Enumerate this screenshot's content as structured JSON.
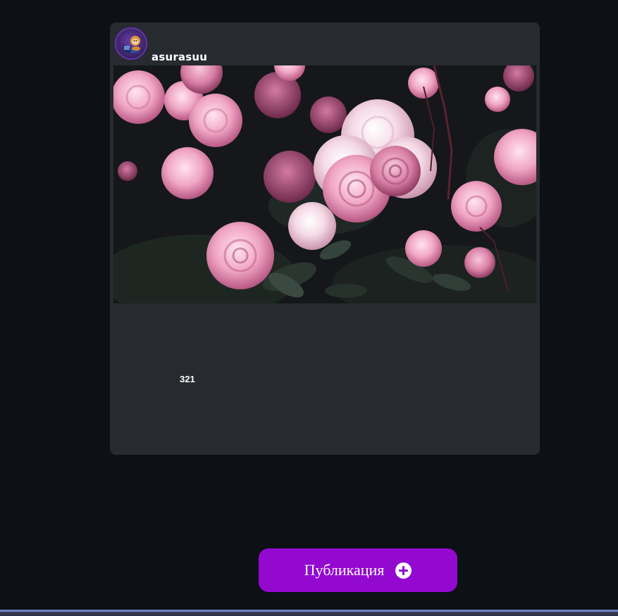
{
  "post": {
    "username": "asurasuu",
    "likes": "321",
    "image_subject": "pink-roses-photo",
    "avatar_subject": "character-with-laptop-avatar"
  },
  "publish_button": {
    "label": "Публикация",
    "icon": "plus-circle-icon",
    "color": "#9309d0"
  },
  "colors": {
    "page_background": "#0d1014",
    "card_background": "#272b2f",
    "accent": "#9309d0"
  }
}
